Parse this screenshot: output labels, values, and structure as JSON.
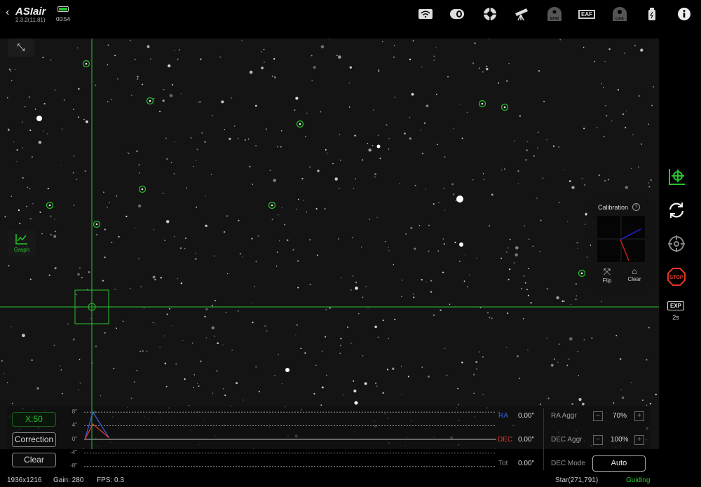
{
  "header": {
    "app_name": "ASIair",
    "version": "2.3.2(11.81)",
    "battery_time": "00:54",
    "icons": [
      "wifi-icon",
      "filter-wheel-icon",
      "guide-scope-icon",
      "telescope-icon",
      "efw-icon",
      "eaf-icon",
      "caa-icon",
      "usb-power-icon",
      "info-icon"
    ],
    "efw_label": "EFW",
    "eaf_label": "EAF",
    "caa_label": "CAA"
  },
  "overlay": {
    "graph_label": "Graph"
  },
  "calibration": {
    "title": "Calibration",
    "help": "?",
    "flip_label": "Flip",
    "clear_label": "Clear"
  },
  "sidebar": {
    "exp_label": "EXP",
    "exp_value": "2s",
    "stop_label": "STOP"
  },
  "guide_panel": {
    "scale_button": "X:50",
    "correction_button": "Correction",
    "clear_button": "Clear",
    "ra_label": "RA",
    "ra_value": "0.00\"",
    "dec_label": "DEC",
    "dec_value": "0.00\"",
    "tot_label": "Tot",
    "tot_value": "0.00\"",
    "ra_aggr_label": "RA Aggr",
    "ra_aggr_value": "70%",
    "dec_aggr_label": "DEC Aggr",
    "dec_aggr_value": "100%",
    "dec_mode_label": "DEC Mode",
    "dec_mode_value": "Auto",
    "minus": "−",
    "plus": "+"
  },
  "chart_data": {
    "type": "line",
    "yticks": [
      "8\"",
      "4\"",
      "0\"",
      "-4\"",
      "-8\""
    ],
    "ylim": [
      -8,
      8
    ],
    "x": [
      0,
      1,
      3
    ],
    "series": [
      {
        "name": "RA",
        "color": "#3a5fe0",
        "values": [
          0,
          8,
          0.5
        ]
      },
      {
        "name": "DEC",
        "color": "#d83a2a",
        "values": [
          0,
          4.5,
          0.5
        ]
      }
    ]
  },
  "status": {
    "resolution": "1936x1216",
    "gain": "Gain: 280",
    "fps": "FPS: 0.3",
    "star": "Star(271,791)",
    "state": "Guiding"
  },
  "colors": {
    "accent": "#27c42e",
    "ra": "#3a5fe0",
    "dec": "#d83a2a",
    "stop": "#e5372a"
  }
}
